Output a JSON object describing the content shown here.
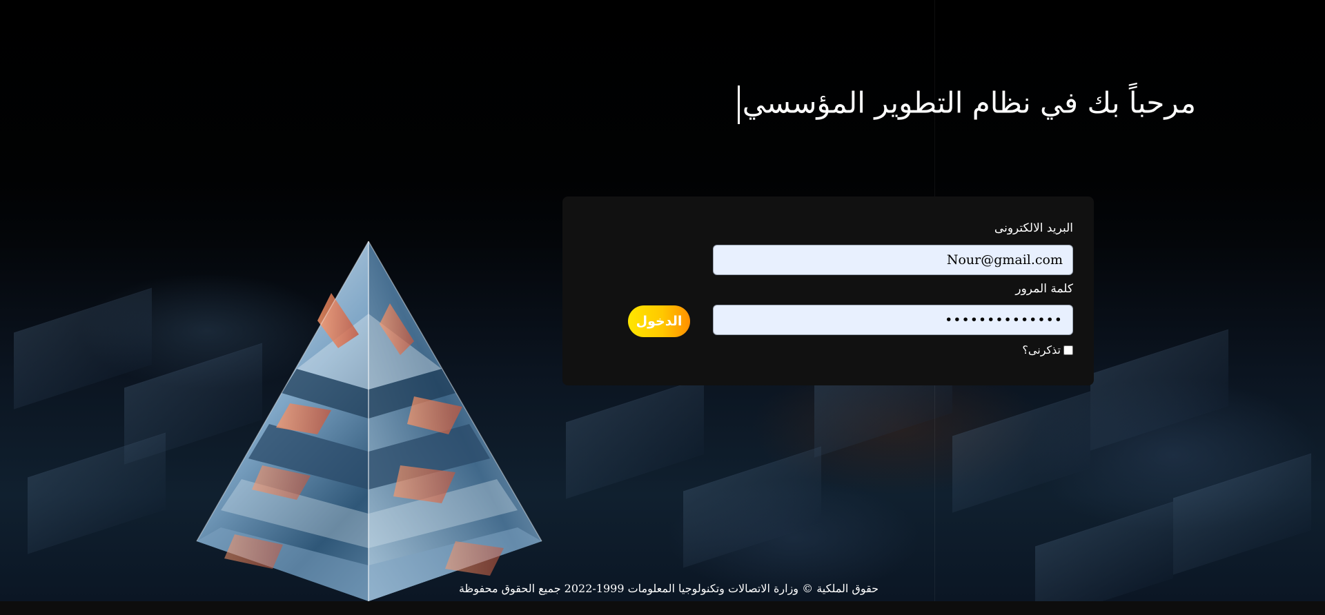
{
  "welcome_title": "مرحباً بك في نظام التطوير المؤسسي",
  "login_form": {
    "email_label": "البريد الالكترونى",
    "email_value": "Nour@gmail.com",
    "password_label": "كلمة المرور",
    "password_value": "••••••••••••••",
    "remember_label": "تذكرنى؟",
    "remember_checked": false,
    "login_button": "الدخول"
  },
  "footer_text": "حقوق الملكية © وزارة الاتصالات وتكنولوجيا المعلومات 1999-2022 جميع الحقوق محفوظة",
  "colors": {
    "button_gradient_start": "#ffe600",
    "button_gradient_end": "#ff8f00",
    "card_background": "#111111",
    "input_background": "#e8f0fe"
  }
}
